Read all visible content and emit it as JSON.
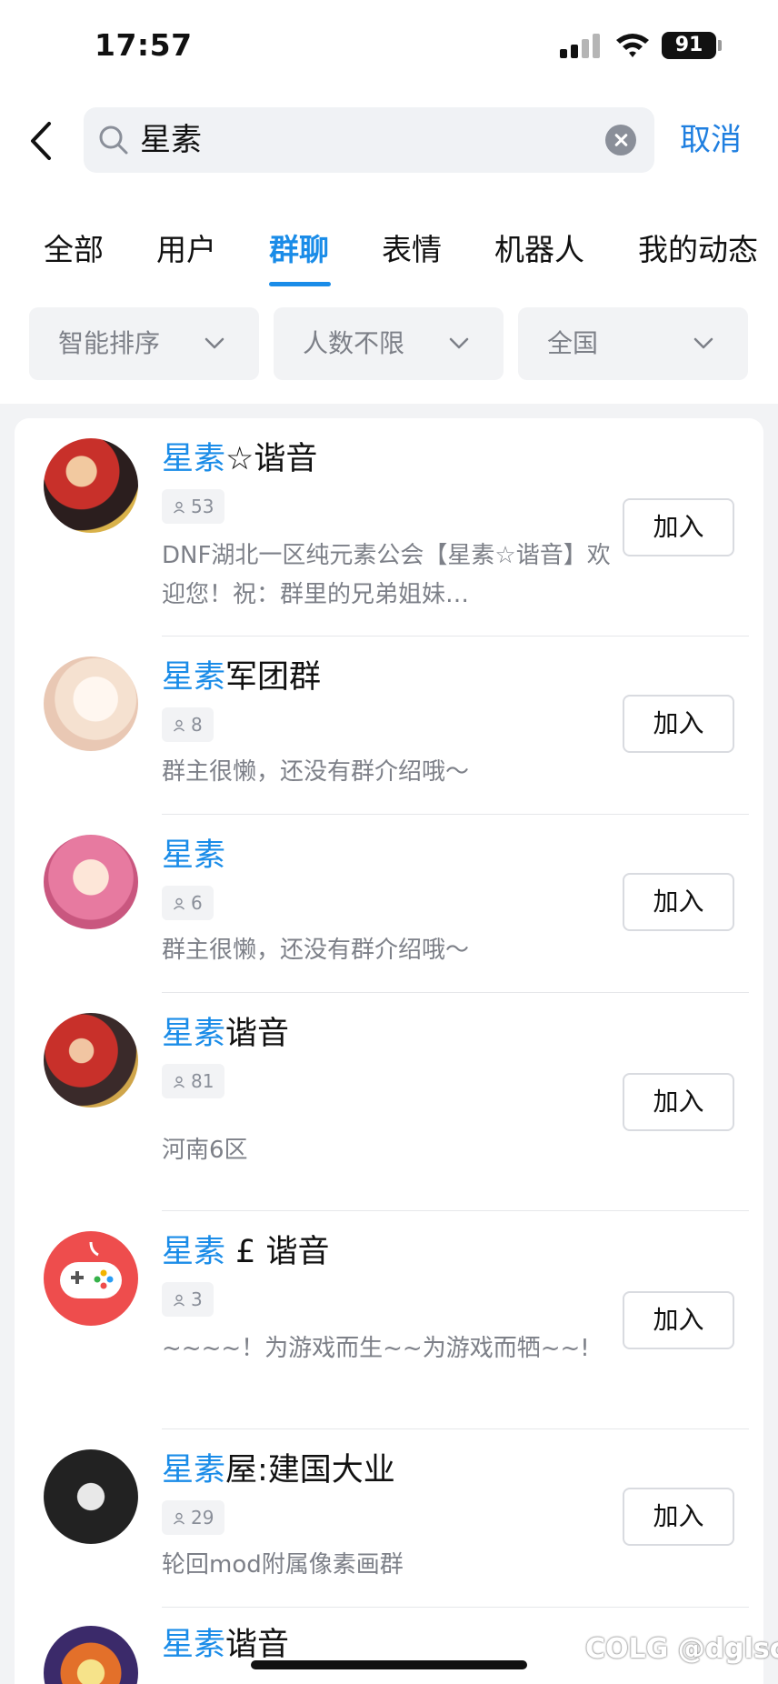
{
  "status_bar": {
    "time": "17:57",
    "battery": "91"
  },
  "search": {
    "query": "星素",
    "cancel_label": "取消"
  },
  "tabs": [
    {
      "label": "全部"
    },
    {
      "label": "用户"
    },
    {
      "label": "群聊"
    },
    {
      "label": "表情"
    },
    {
      "label": "机器人"
    },
    {
      "label": "我的动态"
    }
  ],
  "active_tab": "群聊",
  "filters": [
    {
      "label": "智能排序"
    },
    {
      "label": "人数不限"
    },
    {
      "label": "全国"
    }
  ],
  "groups": [
    {
      "name_highlight": "星素",
      "name_rest": "☆谐音",
      "count": "53",
      "desc": " DNF湖北一区纯元素公会【星素☆谐音】欢迎您！祝：群里的兄弟姐妹…",
      "join_label": "加入"
    },
    {
      "name_highlight": "星素",
      "name_rest": "军团群",
      "count": "8",
      "desc": "群主很懒，还没有群介绍哦～",
      "join_label": "加入"
    },
    {
      "name_highlight": "星素",
      "name_rest": "",
      "count": "6",
      "desc": "群主很懒，还没有群介绍哦～",
      "join_label": "加入"
    },
    {
      "name_highlight": "星素",
      "name_rest": "谐音",
      "count": "81",
      "desc": "河南6区",
      "join_label": "加入"
    },
    {
      "name_highlight": "星素",
      "name_rest": " £ 谐音",
      "count": "3",
      "desc": "~~~~！为游戏而生~~为游戏而牺~~!",
      "join_label": "加入"
    },
    {
      "name_highlight": "星素",
      "name_rest": "屋:建国大业",
      "count": "29",
      "desc": "轮回mod附属像素画群",
      "join_label": "加入"
    },
    {
      "name_highlight": "星素",
      "name_rest": "谐音"
    }
  ],
  "watermark": "COLG @dglsc",
  "colors": {
    "accent": "#1a8ce8",
    "cancel": "#1f7fe0",
    "muted": "#7d8088",
    "game_icon_red": "#ee4d4d"
  }
}
